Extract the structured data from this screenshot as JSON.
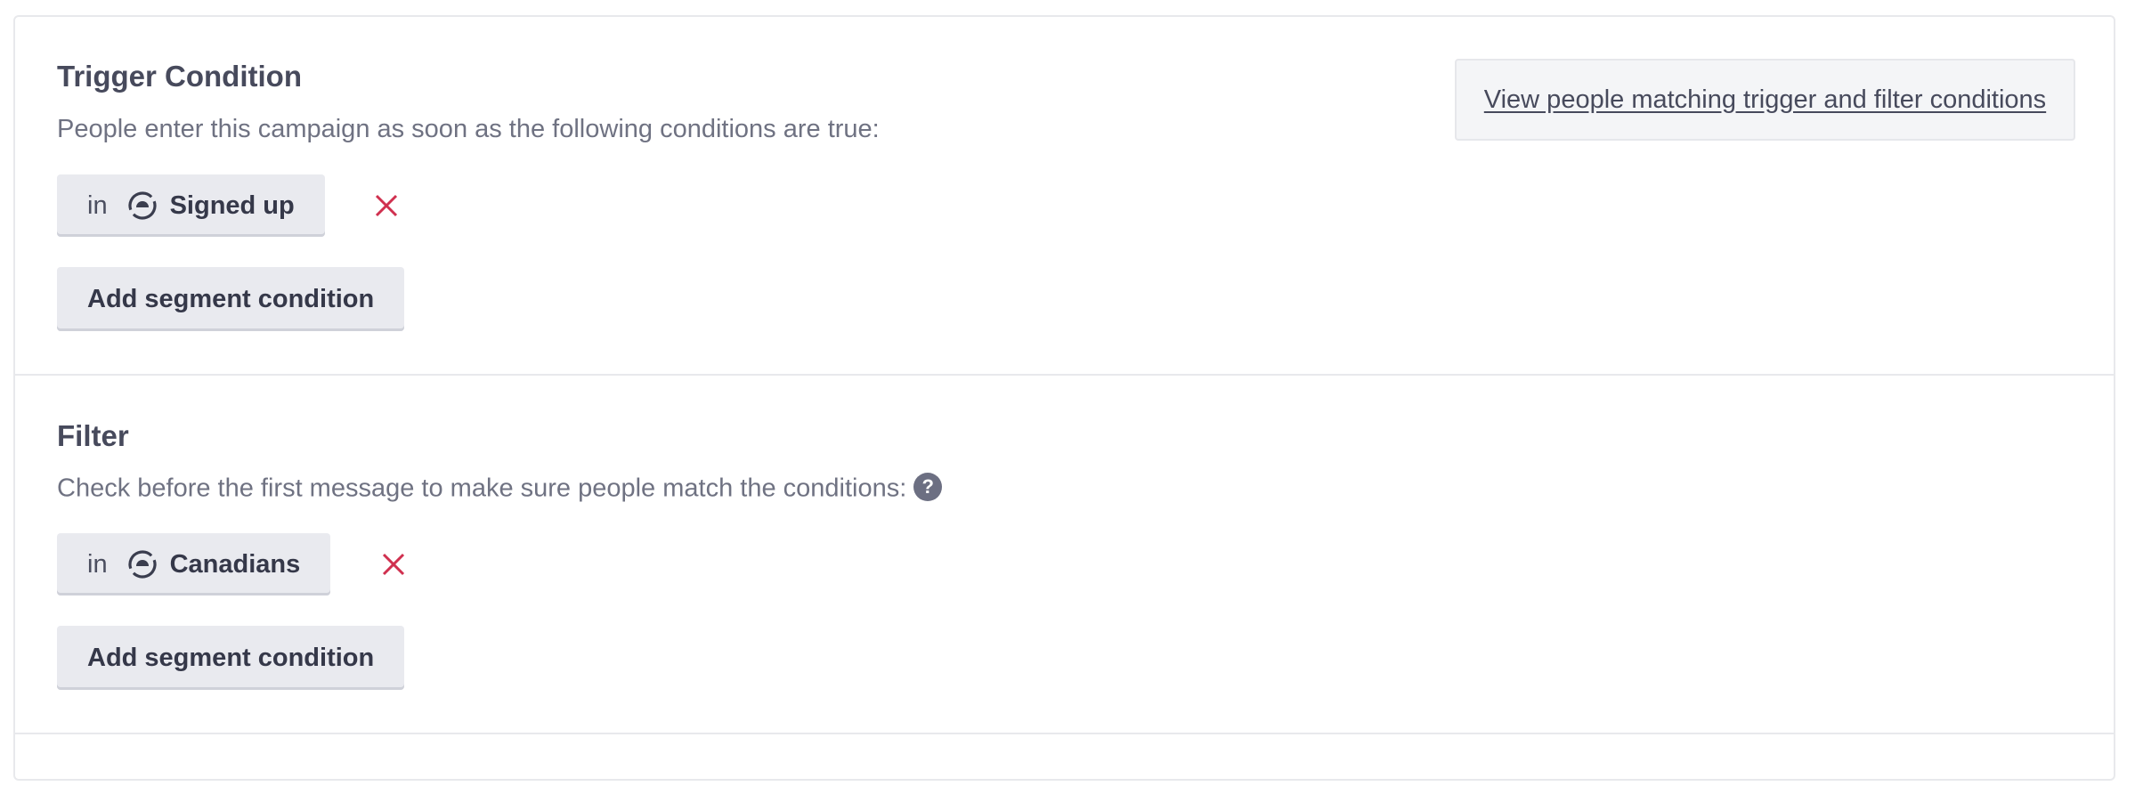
{
  "trigger": {
    "heading": "Trigger Condition",
    "description": "People enter this campaign as soon as the following conditions are true:",
    "view_link": "View people matching trigger and filter conditions",
    "condition": {
      "operator": "in",
      "segment": "Signed up",
      "icon": "segment-icon"
    },
    "add_button": "Add segment condition"
  },
  "filter": {
    "heading": "Filter",
    "description": "Check before the first message to make sure people match the conditions:",
    "help": "?",
    "condition": {
      "operator": "in",
      "segment": "Canadians",
      "icon": "segment-icon"
    },
    "add_button": "Add segment condition"
  },
  "colors": {
    "remove": "#d0304f",
    "chip_bg": "#e9eaef",
    "help_bg": "#6c6f82"
  }
}
